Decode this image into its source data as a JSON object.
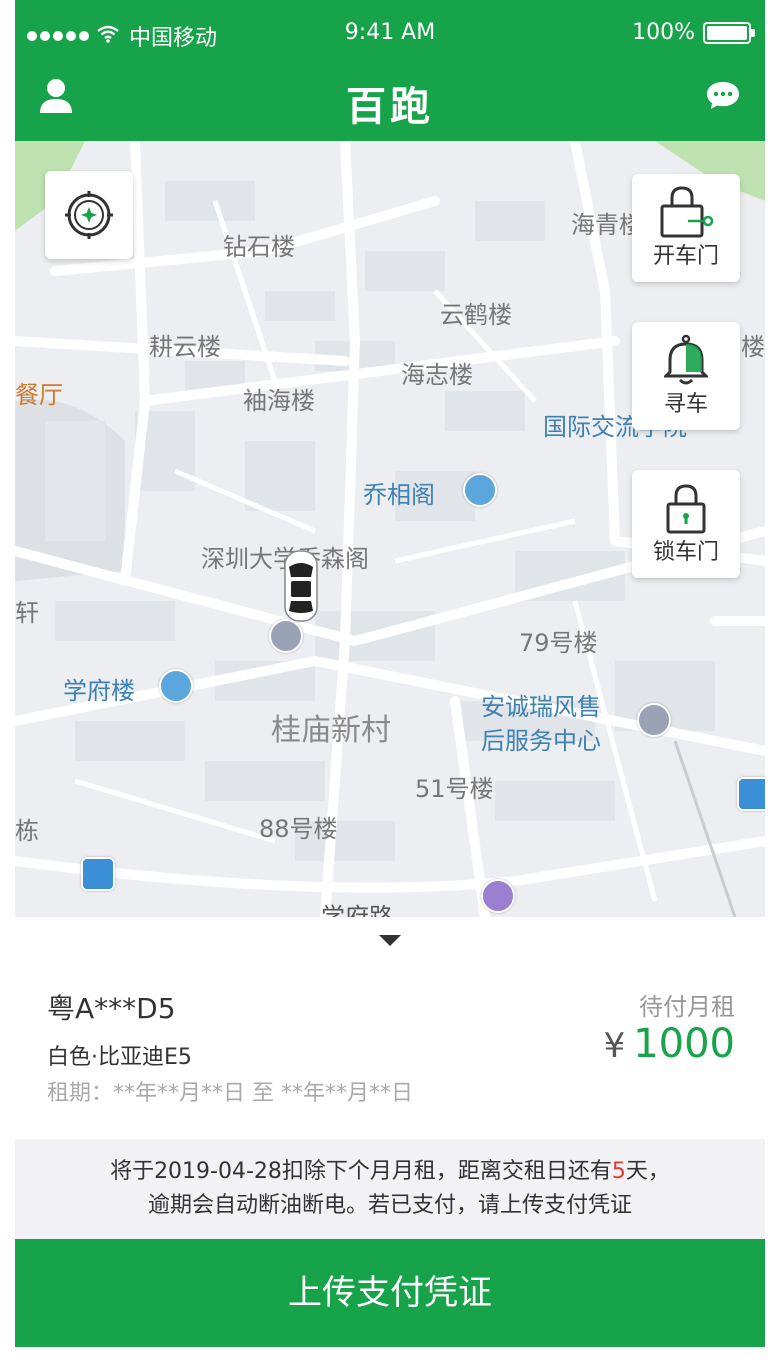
{
  "status_bar": {
    "carrier": "中国移动",
    "time": "9:41 AM",
    "battery": "100%"
  },
  "header": {
    "title": "百跑",
    "profile_icon": "user-icon",
    "message_icon": "chat-bubble-icon"
  },
  "map": {
    "locate_icon": "compass-icon",
    "labels": {
      "zuanshilou": "钻石楼",
      "haiqing": "海青楼",
      "yunhelou": "云鹤楼",
      "gengyunlou": "耕云楼",
      "haizhilou": "海志楼",
      "xiuhailou": "袖海楼",
      "guoji": "国际交流学院",
      "qiaoxiangge": "乔相阁",
      "szu_qiaosen": "深圳大学乔森阁",
      "hao79": "79号楼",
      "xuefulou": "学府楼",
      "guimiao": "桂庙新村",
      "ancheng_line1": "安诚瑞风售",
      "ancheng_line2": "后服务中心",
      "hao51": "51号楼",
      "hao88": "88号楼",
      "xuefulu": "学府路",
      "edge_ting": "餐厅",
      "edge_xuan": "轩",
      "edge_dong": "栋",
      "edge_lou": "楼"
    }
  },
  "controls": {
    "unlock": {
      "label": "开车门",
      "icon": "unlock-icon"
    },
    "find": {
      "label": "寻车",
      "icon": "bell-icon"
    },
    "lock": {
      "label": "锁车门",
      "icon": "lock-icon"
    }
  },
  "vehicle": {
    "plate": "粤A***D5",
    "model": "白色·比亚迪E5",
    "period": "租期：**年**月**日 至 **年**月**日",
    "due_label": "待付月租",
    "currency": "¥",
    "amount": "1000"
  },
  "notice": {
    "line1_prefix": "将于2019-04-28扣除下个月月租，距离交租日还有",
    "days": "5",
    "line1_suffix": "天，",
    "line2": "逾期会自动断油断电。若已支付，请上传支付凭证"
  },
  "upload_button": "上传支付凭证",
  "colors": {
    "brand_green": "#17a34a",
    "warning_red": "#e53935"
  }
}
